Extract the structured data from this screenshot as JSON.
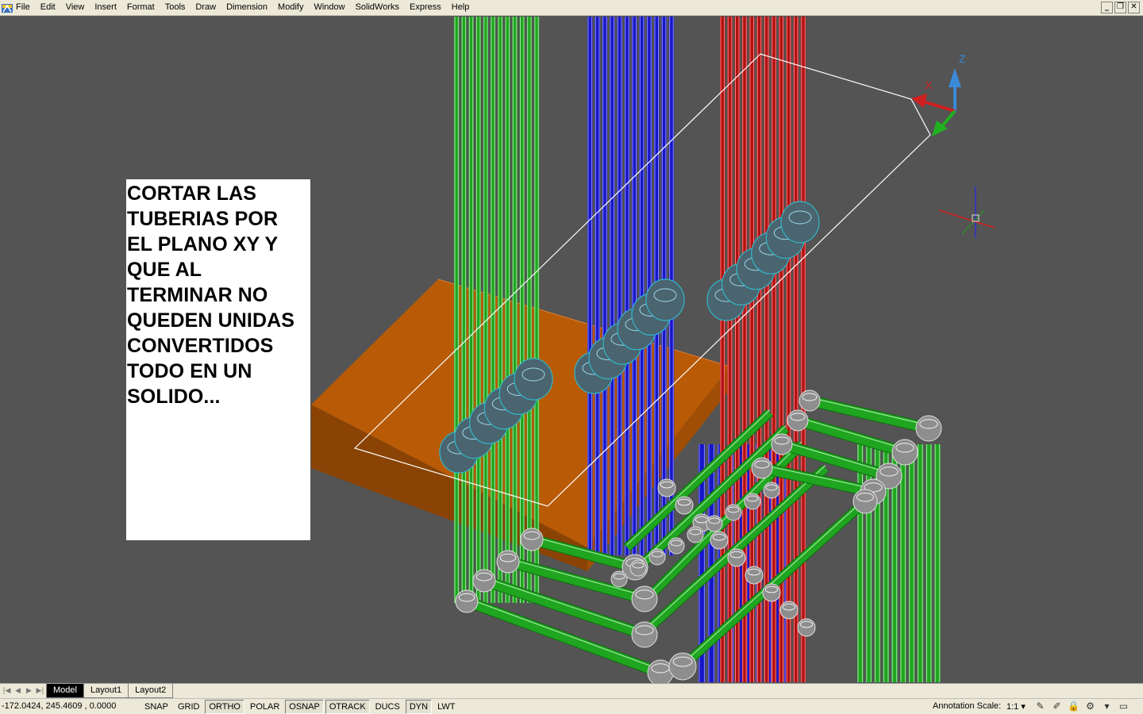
{
  "menubar": {
    "app_icon": "autocad-app-icon",
    "items": [
      "File",
      "Edit",
      "View",
      "Insert",
      "Format",
      "Tools",
      "Draw",
      "Dimension",
      "Modify",
      "Window",
      "SolidWorks",
      "Express",
      "Help"
    ],
    "window_controls": {
      "minimize": "_",
      "restore": "❐",
      "close": "✕"
    }
  },
  "note": {
    "lines": [
      "CORTAR LAS",
      "TUBERIAS POR",
      "EL PLANO XY Y",
      "QUE AL",
      "TERMINAR NO",
      "QUEDEN UNIDAS",
      "CONVERTIDOS",
      "TODO EN UN",
      "SOLIDO..."
    ]
  },
  "ucs": {
    "x_label": "X",
    "z_label": "Z"
  },
  "colors": {
    "viewport_bg": "#545454",
    "green_pipe": "#1fa51f",
    "blue_pipe": "#1616c8",
    "red_pipe": "#b01010",
    "slab": "#b85a06",
    "fittings": "#b8b8b8",
    "fittings_cyan": "#30b8c8"
  },
  "tabs": {
    "nav": [
      "|◀",
      "◀",
      "▶",
      "▶|"
    ],
    "items": [
      {
        "label": "Model",
        "active": true
      },
      {
        "label": "Layout1",
        "active": false
      },
      {
        "label": "Layout2",
        "active": false
      }
    ]
  },
  "statusbar": {
    "coords": "-172.0424, 245.4609 , 0.0000",
    "toggles": [
      {
        "label": "SNAP",
        "on": false
      },
      {
        "label": "GRID",
        "on": false
      },
      {
        "label": "ORTHO",
        "on": true
      },
      {
        "label": "POLAR",
        "on": false
      },
      {
        "label": "OSNAP",
        "on": true
      },
      {
        "label": "OTRACK",
        "on": true
      },
      {
        "label": "DUCS",
        "on": false
      },
      {
        "label": "DYN",
        "on": true
      },
      {
        "label": "LWT",
        "on": false
      }
    ],
    "annotation_label": "Annotation Scale:",
    "annotation_value": "1:1 ▾",
    "tray_icons": [
      "annotation-visibility-icon",
      "auto-scale-icon",
      "lock-icon",
      "tray-settings-icon",
      "menu-arrow-icon",
      "clean-screen-icon"
    ]
  }
}
